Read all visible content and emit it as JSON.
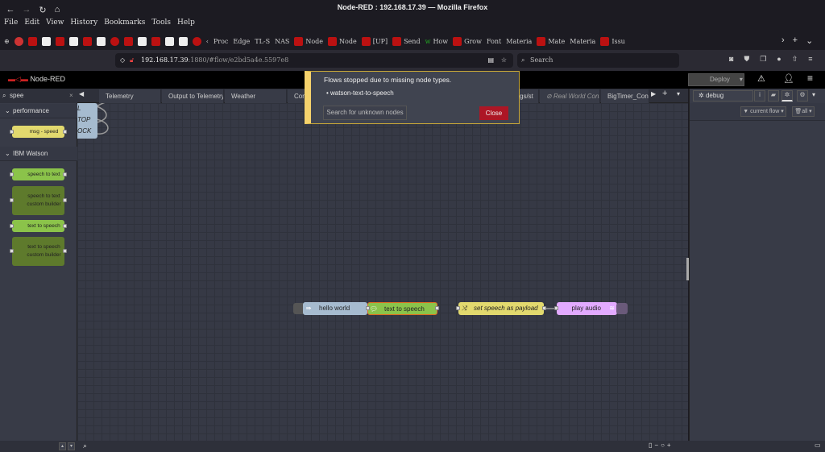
{
  "window": {
    "title": "Node-RED : 192.168.17.39 — Mozilla Firefox"
  },
  "menu": [
    "File",
    "Edit",
    "View",
    "History",
    "Bookmarks",
    "Tools",
    "Help"
  ],
  "bookmarks": [
    "Proc",
    "Edge",
    "TL-S",
    "NAS",
    "Node",
    "Node",
    "[UP]",
    "Send",
    "How",
    "Grow",
    "Font",
    "Materia",
    "Mate",
    "Materia",
    "Issu"
  ],
  "nav": {
    "url_host": "192.168.17.39",
    "url_rest": ":1880/#flow/e2bd5a4e.5597e8",
    "search_placeholder": "Search"
  },
  "header": {
    "app_name": "Node-RED",
    "deploy_label": "Deploy"
  },
  "palette": {
    "search_value": "spee",
    "categories": [
      {
        "label": "performance",
        "nodes": [
          "msg - speed"
        ]
      },
      {
        "label": "IBM Watson",
        "nodes": [
          "speech to text",
          "speech to text custom builder",
          "text to speech",
          "text to speech custom builder"
        ]
      }
    ]
  },
  "tabs": [
    "Telemetry",
    "Output to Telemetry",
    "Weather",
    "Con",
    "gs/st",
    "Real World Cont",
    "BigTimer_Contr"
  ],
  "workspace": {
    "partial_nodes": [
      "L",
      "TOP",
      "OCK"
    ],
    "flow_nodes": [
      "hello world",
      "text to speech",
      "set speech as payload",
      "play audio"
    ]
  },
  "notification": {
    "message": "Flows stopped due to missing node types.",
    "missing": [
      "watson-text-to-speech"
    ],
    "search_button": "Search for unknown nodes",
    "close_button": "Close"
  },
  "sidebar": {
    "tab_label": "debug",
    "filter_label": "current flow",
    "clear_label": "all"
  },
  "colors": {
    "watson": "#8bc34a",
    "function": "#e2d96e",
    "inject": "#a6bbcf",
    "audio": "#e2aaff",
    "alert": "#f5d26c",
    "close": "#ad1625"
  }
}
